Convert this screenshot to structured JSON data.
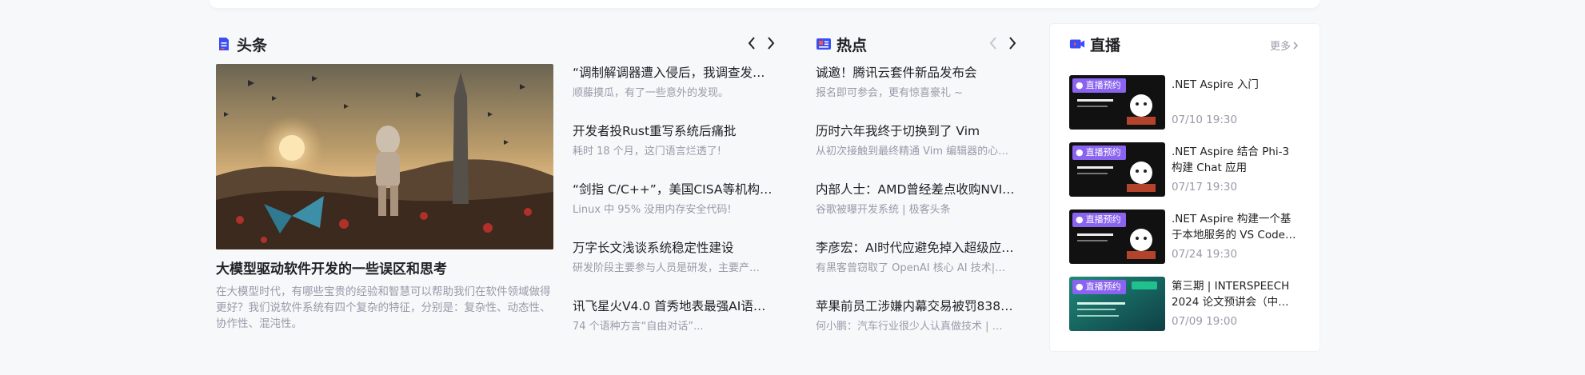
{
  "headline": {
    "section_title": "头条",
    "feature": {
      "title": "大模型驱动软件开发的一些误区和思考",
      "description": "在大模型时代，有哪些宝贵的经验和智慧可以帮助我们在软件领域做得更好？我们说软件系统有四个复杂的特征，分别是：复杂性、动态性、协作性、混沌性。"
    },
    "items": [
      {
        "title": "“调制解调器遭入侵后，我调查发现…",
        "subtitle": "顺藤摸瓜，有了一些意外的发现。"
      },
      {
        "title": "开发者投Rust重写系统后痛批",
        "subtitle": "耗时 18 个月，这门语言烂透了!"
      },
      {
        "title": "“剑指 C/C++”，美国CISA等机构…",
        "subtitle": "Linux 中 95% 没用内存安全代码!"
      },
      {
        "title": "万字长文浅谈系统稳定性建设",
        "subtitle": "研发阶段主要参与人员是研发，主要产…"
      },
      {
        "title": "讯飞星火V4.0 首秀地表最强AI语…",
        "subtitle": "74 个语种方言“自由对话”..."
      }
    ]
  },
  "hot": {
    "section_title": "热点",
    "items": [
      {
        "title": "诚邀！腾讯云套件新品发布会",
        "subtitle": "报名即可参会，更有惊喜豪礼 ~"
      },
      {
        "title": "历时六年我终于切换到了 Vim",
        "subtitle": "从初次接触到最终精通 Vim 编辑器的心…"
      },
      {
        "title": "内部人士：AMD曾经差点收购NVI…",
        "subtitle": "谷歌被曝开发系统 | 极客头条"
      },
      {
        "title": "李彦宏：AI时代应避免掉入超级应…",
        "subtitle": "有黑客曾窃取了 OpenAI 核心 AI 技术|…"
      },
      {
        "title": "苹果前员工涉嫌内幕交易被罚838…",
        "subtitle": "何小鹏：汽车行业很少人认真做技术 | …"
      }
    ]
  },
  "live": {
    "section_title": "直播",
    "more_label": "更多",
    "items": [
      {
        "badge": "直播预约",
        "title": ".NET Aspire 入门",
        "time": "07/10 19:30",
        "thumb": "dark"
      },
      {
        "badge": "直播预约",
        "title": ".NET Aspire 结合 Phi-3 构建 Chat 应用",
        "time": "07/17 19:30",
        "thumb": "dark"
      },
      {
        "badge": "直播预约",
        "title": ".NET Aspire 构建一个基于本地服务的 VS Code…",
        "time": "07/24 19:30",
        "thumb": "dark"
      },
      {
        "badge": "直播预约",
        "title": "第三期 | INTERSPEECH 2024 论文预讲会（中…",
        "time": "07/09 19:00",
        "thumb": "teal"
      }
    ]
  },
  "colors": {
    "accent_blue": "#3b4ef5",
    "badge_purple": "#8a63f0",
    "text_primary": "#222226",
    "text_secondary": "#999aaa"
  }
}
